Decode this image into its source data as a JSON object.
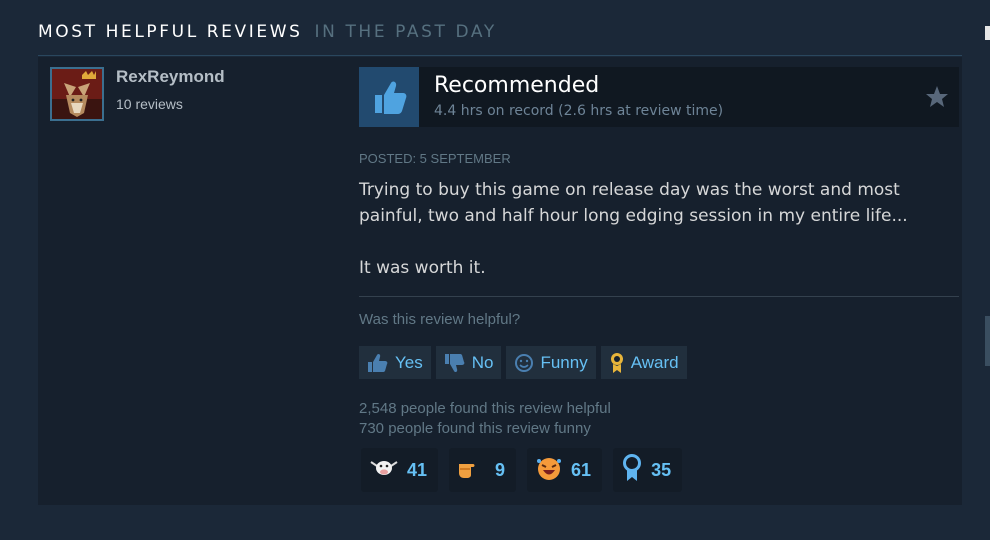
{
  "section": {
    "title": "MOST HELPFUL REVIEWS",
    "subtitle": "IN THE PAST DAY"
  },
  "review": {
    "author": {
      "name": "RexReymond",
      "review_count": "10 reviews"
    },
    "verdict": "Recommended",
    "hours": "4.4 hrs on record (2.6 hrs at review time)",
    "posted": "POSTED: 5 SEPTEMBER",
    "body": [
      "Trying to buy this game on release day was the worst and most painful, two and half hour long edging session in my entire life...",
      "It was worth it."
    ],
    "helpful_prompt": "Was this review helpful?",
    "buttons": {
      "yes": "Yes",
      "no": "No",
      "funny": "Funny",
      "award": "Award"
    },
    "stats": {
      "helpful": "2,548 people found this review helpful",
      "funny": "730 people found this review funny"
    },
    "awards": [
      {
        "icon": "cow-award-icon",
        "count": "41"
      },
      {
        "icon": "pointing-hand-award-icon",
        "count": "9"
      },
      {
        "icon": "laughing-face-award-icon",
        "count": "61"
      },
      {
        "icon": "ribbon-award-icon",
        "count": "35"
      }
    ]
  },
  "colors": {
    "background": "#1b2838",
    "card": "#16202d",
    "accent": "#66c0f4",
    "muted": "#617886"
  }
}
